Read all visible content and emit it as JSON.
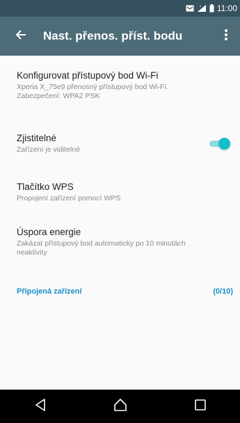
{
  "status_bar": {
    "time": "11:00",
    "icons": [
      "notification-icon",
      "signal-icon",
      "battery-icon"
    ]
  },
  "app_bar": {
    "title": "Nast. přenos. příst. bodu",
    "back_icon": "arrow-back-icon",
    "menu_icon": "more-vert-icon"
  },
  "settings": {
    "configure": {
      "title": "Konfigurovat přístupový bod Wi-Fi",
      "sub_line1": "Xperia X_75e9 přenosný přístupový bod Wi-Fi.",
      "sub_line2": "Zabezpečení: WPA2 PSK"
    },
    "discoverable": {
      "title": "Zjistitelné",
      "sub": "Zařízení je viditelné",
      "toggle_on": true
    },
    "wps": {
      "title": "Tlačítko WPS",
      "sub": "Propojení zařízení pomocí WPS"
    },
    "energy": {
      "title": "Úspora energie",
      "sub_line1": "Zakázat přístupový bod automaticky po 10 minutách",
      "sub_line2": "neaktivity"
    },
    "connected_devices": {
      "label": "Připojená zařízení",
      "count": "(0/10)"
    }
  },
  "colors": {
    "status_bar": "#37525f",
    "app_bar": "#4e6b78",
    "accent": "#14bfc9",
    "link": "#1a8fc9"
  },
  "nav_bar": {
    "icons": [
      "back-triangle-icon",
      "home-icon",
      "recents-icon"
    ]
  }
}
